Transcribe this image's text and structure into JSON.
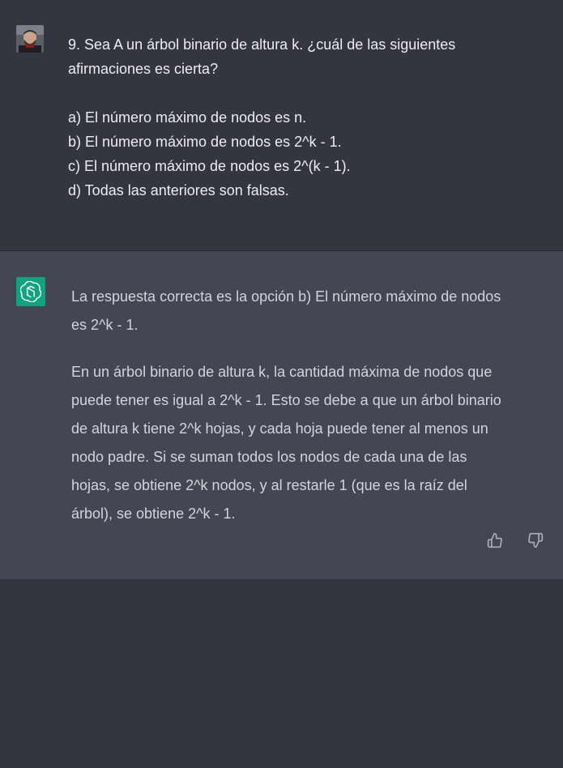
{
  "user_message": {
    "avatar": "user-avatar-photo",
    "lines": [
      "9. Sea A un árbol binario de altura k. ¿cuál de las siguientes",
      "afirmaciones es cierta?",
      "a) El número máximo de nodos es n.",
      "b) El número máximo de nodos es 2^k - 1.",
      "c) El número máximo de nodos es 2^(k - 1).",
      "d) Todas las anteriores son falsas."
    ]
  },
  "assistant_message": {
    "avatar": "openai-logo-icon",
    "avatar_color": "#10a37f",
    "paragraph1_lines": [
      "La respuesta correcta es la opción b) El número máximo de nodos",
      "es 2^k - 1."
    ],
    "paragraph2_lines": [
      "En un árbol binario de altura k, la cantidad máxima de nodos que",
      "puede tener es igual a 2^k - 1. Esto se debe a que un árbol binario",
      "de altura k tiene 2^k hojas, y cada hoja puede tener al menos un",
      "nodo padre. Si se suman todos los nodos de cada una de las",
      "hojas, se obtiene 2^k nodos, y al restarle 1 (que es la raíz del",
      "árbol), se obtiene 2^k - 1."
    ],
    "feedback_icons": [
      "thumbs-up-icon",
      "thumbs-down-icon"
    ]
  },
  "colors": {
    "user_bg": "#343541",
    "assistant_bg": "#444654",
    "text": "#ececf1"
  }
}
